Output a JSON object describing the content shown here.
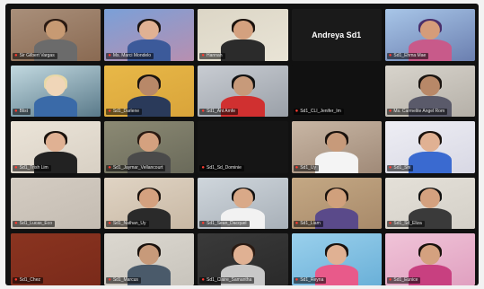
{
  "meeting": {
    "participants": [
      {
        "name": "Sir Gilbert Vargas",
        "speaker": false,
        "bg": "#8a6a52",
        "skin": "#c79a73",
        "hair": "#2a1a12",
        "shirt": "#6b6b6b",
        "wall": "#a98f7a"
      },
      {
        "name": "Ms. Marci Mondelo",
        "speaker": true,
        "bg": "#b88fb0",
        "skin": "#e0b193",
        "hair": "#1b1410",
        "shirt": "#3c5a9a",
        "wall": "#7aa0d8"
      },
      {
        "name": "Hannah",
        "speaker": false,
        "bg": "#e9e4d6",
        "skin": "#d4a17f",
        "hair": "#1a120d",
        "shirt": "#2b2b2b",
        "wall": "#dcd6c6"
      },
      {
        "name": "Andreya Sd1",
        "speaker": false,
        "bg": "#1a1a1a",
        "label_only": true
      },
      {
        "name": "Sd1_Ehma Mae",
        "speaker": false,
        "bg": "#6b7fb0",
        "skin": "#d59c7a",
        "hair": "#4a2f6b",
        "shirt": "#c85a8a",
        "wall": "#a8c6e8"
      },
      {
        "name": "Blist",
        "speaker": false,
        "bg": "#5a7a8a",
        "skin": "#f0d6b8",
        "hair": "#e8d8a8",
        "shirt": "#3a6aa8",
        "wall": "#c2d9e0"
      },
      {
        "name": "Sd1_Darlene",
        "speaker": false,
        "bg": "#d9a43a",
        "skin": "#b88868",
        "hair": "#1a1410",
        "shirt": "#2a3a5a",
        "wall": "#e8b848"
      },
      {
        "name": "Sd1_Ant Amfe",
        "speaker": false,
        "bg": "#9aa0a8",
        "skin": "#c79a7a",
        "hair": "#121212",
        "shirt": "#d03030",
        "wall": "#c8ccd2"
      },
      {
        "name": "Sd1_CLI_Jenifer_Im",
        "speaker": false,
        "bg": "#111111",
        "skin": "#c79a7a",
        "hair": "#111111",
        "shirt": "#111111",
        "wall": "#111111",
        "empty": true
      },
      {
        "name": "Ms. Carmelite Angel Rom",
        "speaker": false,
        "bg": "#b5b0a8",
        "skin": "#b88868",
        "hair": "#1a1410",
        "shirt": "#5a5a6a",
        "wall": "#d8d4cc"
      },
      {
        "name": "Sd1_Trish Lim",
        "speaker": false,
        "bg": "#d8d0c4",
        "skin": "#e0b193",
        "hair": "#1a120d",
        "shirt": "#222222",
        "wall": "#ebe4d8"
      },
      {
        "name": "Sd1_Jaymar_Vellancourt",
        "speaker": false,
        "bg": "#6a6a5a",
        "skin": "#d4a17f",
        "hair": "#2a1a12",
        "shirt": "#4a4a4a",
        "wall": "#8c8a74"
      },
      {
        "name": "Sd1_Sd_Dominie",
        "speaker": false,
        "bg": "#151515",
        "skin": "#151515",
        "hair": "#151515",
        "shirt": "#151515",
        "wall": "#151515",
        "empty": true
      },
      {
        "name": "Sd1_Uy",
        "speaker": false,
        "bg": "#a08a78",
        "skin": "#c79a7a",
        "hair": "#1a120d",
        "shirt": "#f4f4f4",
        "wall": "#c8b6a4"
      },
      {
        "name": "Sd1_Shi",
        "speaker": false,
        "bg": "#d8d8e4",
        "skin": "#e0b193",
        "hair": "#1a120d",
        "shirt": "#3a6ad0",
        "wall": "#eeeef4"
      },
      {
        "name": "Sd1_Lucas_Eco",
        "speaker": false,
        "bg": "#c4bcb2",
        "skin": "#c4bcb2",
        "hair": "#c4bcb2",
        "shirt": "#c4bcb2",
        "wall": "#d4ccc2",
        "empty": true
      },
      {
        "name": "Sd1_Nathan_Uy",
        "speaker": false,
        "bg": "#c8b8a4",
        "skin": "#d4a17f",
        "hair": "#1a120d",
        "shirt": "#2a2a2a",
        "wall": "#e0d4c4"
      },
      {
        "name": "Sd1_Sean_Dacquel",
        "speaker": false,
        "bg": "#a8b0b8",
        "skin": "#d9a988",
        "hair": "#111111",
        "shirt": "#f2f2f2",
        "wall": "#cfd6dc"
      },
      {
        "name": "Sd1_Liam",
        "speaker": false,
        "bg": "#a88a6a",
        "skin": "#d0a07c",
        "hair": "#1a120d",
        "shirt": "#5a4a8a",
        "wall": "#c4a884"
      },
      {
        "name": "Sd1_Sd_Eliza",
        "speaker": false,
        "bg": "#d4d0c8",
        "skin": "#d4a17f",
        "hair": "#111111",
        "shirt": "#3a3a3a",
        "wall": "#e4e0d8"
      },
      {
        "name": "Sd1_Chez",
        "speaker": false,
        "bg": "#7a2a1a",
        "skin": "#7a2a1a",
        "hair": "#7a2a1a",
        "shirt": "#7a2a1a",
        "wall": "#8a3420",
        "empty": true
      },
      {
        "name": "Sd1_Marcus",
        "speaker": false,
        "bg": "#c8c4bc",
        "skin": "#c79a7a",
        "hair": "#1a120d",
        "shirt": "#4a5a6a",
        "wall": "#dcd8d0"
      },
      {
        "name": "Sd1_Claire_Samantha",
        "speaker": false,
        "bg": "#2a2a2a",
        "skin": "#e0b193",
        "hair": "#2a1a12",
        "shirt": "#c8c8c8",
        "wall": "#3a3a3a"
      },
      {
        "name": "Sd1_Reyna",
        "speaker": false,
        "bg": "#6ab0d8",
        "skin": "#e0b193",
        "hair": "#1a120d",
        "shirt": "#e85a8a",
        "wall": "#9ad0ec"
      },
      {
        "name": "Sd1_Eunice",
        "speaker": false,
        "bg": "#e0a0c0",
        "skin": "#d4a17f",
        "hair": "#1a120d",
        "shirt": "#c84080",
        "wall": "#f0c4d8"
      }
    ],
    "mic_icon_color": "#ff3b30",
    "active_speaker_color": "#d8c52e"
  }
}
